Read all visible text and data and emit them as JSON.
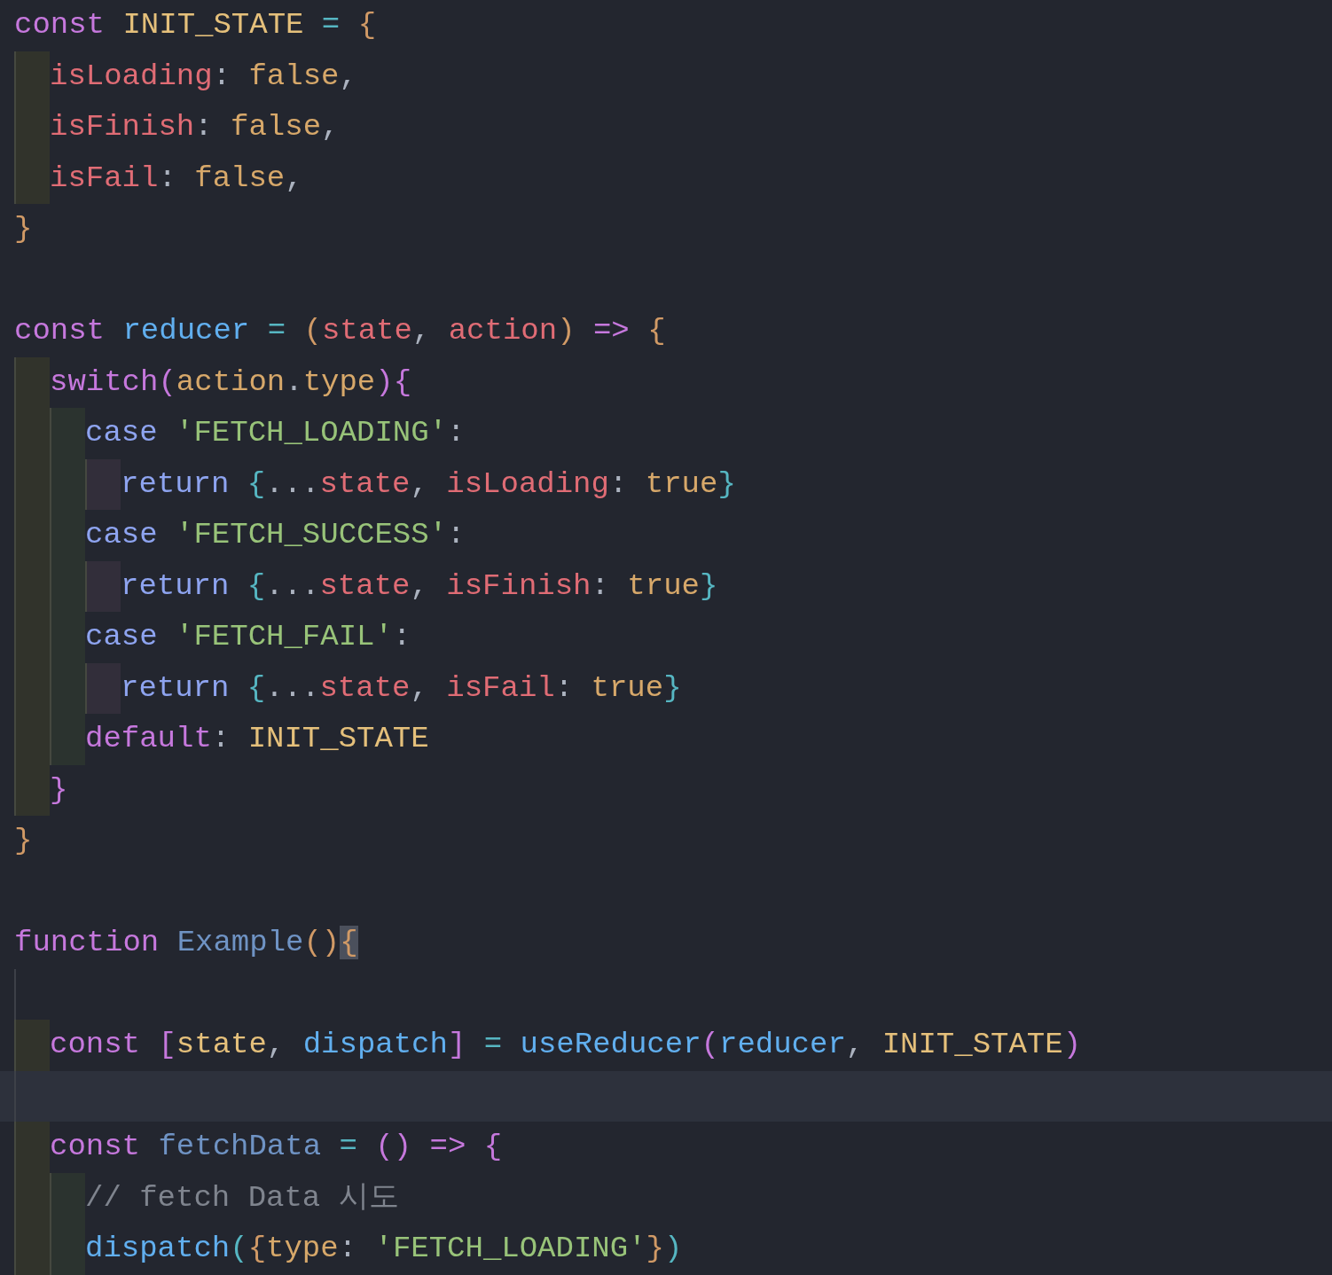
{
  "editor": {
    "lines": [
      {
        "kind": "code",
        "tokens": [
          {
            "kind": "kw",
            "text": "const "
          },
          {
            "kind": "const",
            "text": "INIT_STATE"
          },
          {
            "kind": "op",
            "text": " = "
          },
          {
            "kind": "b1",
            "text": "{"
          }
        ],
        "children": [
          {
            "kind": "code",
            "tokens": [
              {
                "kind": "prop",
                "text": "isLoading"
              },
              {
                "kind": "punc",
                "text": ": "
              },
              {
                "kind": "lit",
                "text": "false"
              },
              {
                "kind": "punc",
                "text": ","
              }
            ]
          },
          {
            "kind": "code",
            "tokens": [
              {
                "kind": "prop",
                "text": "isFinish"
              },
              {
                "kind": "punc",
                "text": ": "
              },
              {
                "kind": "lit",
                "text": "false"
              },
              {
                "kind": "punc",
                "text": ","
              }
            ]
          },
          {
            "kind": "code",
            "tokens": [
              {
                "kind": "prop",
                "text": "isFail"
              },
              {
                "kind": "punc",
                "text": ": "
              },
              {
                "kind": "lit",
                "text": "false"
              },
              {
                "kind": "punc",
                "text": ","
              }
            ]
          }
        ]
      },
      {
        "kind": "code",
        "tokens": [
          {
            "kind": "b1",
            "text": "}"
          }
        ]
      },
      {
        "kind": "blank"
      },
      {
        "kind": "code",
        "tokens": [
          {
            "kind": "kw",
            "text": "const "
          },
          {
            "kind": "call",
            "text": "reducer"
          },
          {
            "kind": "op",
            "text": " = "
          },
          {
            "kind": "b1",
            "text": "("
          },
          {
            "kind": "prop",
            "text": "state"
          },
          {
            "kind": "punc",
            "text": ", "
          },
          {
            "kind": "prop",
            "text": "action"
          },
          {
            "kind": "b1",
            "text": ")"
          },
          {
            "kind": "kw",
            "text": " => "
          },
          {
            "kind": "b1",
            "text": "{"
          }
        ],
        "children": [
          {
            "kind": "code",
            "tokens": [
              {
                "kind": "kw",
                "text": "switch"
              },
              {
                "kind": "b2",
                "text": "("
              },
              {
                "kind": "lit",
                "text": "action"
              },
              {
                "kind": "punc",
                "text": "."
              },
              {
                "kind": "lit",
                "text": "type"
              },
              {
                "kind": "b2",
                "text": ")"
              },
              {
                "kind": "b2",
                "text": "{"
              }
            ],
            "children": [
              {
                "kind": "code",
                "tokens": [
                  {
                    "kind": "ctl",
                    "text": "case "
                  },
                  {
                    "kind": "str",
                    "text": "'FETCH_LOADING'"
                  },
                  {
                    "kind": "punc",
                    "text": ":"
                  }
                ],
                "children": [
                  {
                    "kind": "code",
                    "tokens": [
                      {
                        "kind": "ctl",
                        "text": "return "
                      },
                      {
                        "kind": "b3",
                        "text": "{"
                      },
                      {
                        "kind": "punc",
                        "text": "..."
                      },
                      {
                        "kind": "prop",
                        "text": "state"
                      },
                      {
                        "kind": "punc",
                        "text": ", "
                      },
                      {
                        "kind": "prop",
                        "text": "isLoading"
                      },
                      {
                        "kind": "punc",
                        "text": ": "
                      },
                      {
                        "kind": "lit",
                        "text": "true"
                      },
                      {
                        "kind": "b3",
                        "text": "}"
                      }
                    ]
                  }
                ]
              },
              {
                "kind": "code",
                "tokens": [
                  {
                    "kind": "ctl",
                    "text": "case "
                  },
                  {
                    "kind": "str",
                    "text": "'FETCH_SUCCESS'"
                  },
                  {
                    "kind": "punc",
                    "text": ":"
                  }
                ],
                "children": [
                  {
                    "kind": "code",
                    "tokens": [
                      {
                        "kind": "ctl",
                        "text": "return "
                      },
                      {
                        "kind": "b3",
                        "text": "{"
                      },
                      {
                        "kind": "punc",
                        "text": "..."
                      },
                      {
                        "kind": "prop",
                        "text": "state"
                      },
                      {
                        "kind": "punc",
                        "text": ", "
                      },
                      {
                        "kind": "prop",
                        "text": "isFinish"
                      },
                      {
                        "kind": "punc",
                        "text": ": "
                      },
                      {
                        "kind": "lit",
                        "text": "true"
                      },
                      {
                        "kind": "b3",
                        "text": "}"
                      }
                    ]
                  }
                ]
              },
              {
                "kind": "code",
                "tokens": [
                  {
                    "kind": "ctl",
                    "text": "case "
                  },
                  {
                    "kind": "str",
                    "text": "'FETCH_FAIL'"
                  },
                  {
                    "kind": "punc",
                    "text": ":"
                  }
                ],
                "children": [
                  {
                    "kind": "code",
                    "tokens": [
                      {
                        "kind": "ctl",
                        "text": "return "
                      },
                      {
                        "kind": "b3",
                        "text": "{"
                      },
                      {
                        "kind": "punc",
                        "text": "..."
                      },
                      {
                        "kind": "prop",
                        "text": "state"
                      },
                      {
                        "kind": "punc",
                        "text": ", "
                      },
                      {
                        "kind": "prop",
                        "text": "isFail"
                      },
                      {
                        "kind": "punc",
                        "text": ": "
                      },
                      {
                        "kind": "lit",
                        "text": "true"
                      },
                      {
                        "kind": "b3",
                        "text": "}"
                      }
                    ]
                  }
                ]
              },
              {
                "kind": "code",
                "tokens": [
                  {
                    "kind": "kw",
                    "text": "default"
                  },
                  {
                    "kind": "punc",
                    "text": ": "
                  },
                  {
                    "kind": "const",
                    "text": "INIT_STATE"
                  }
                ]
              }
            ]
          },
          {
            "kind": "code",
            "tokens": [
              {
                "kind": "b2",
                "text": "}"
              }
            ]
          }
        ]
      },
      {
        "kind": "code",
        "tokens": [
          {
            "kind": "b1",
            "text": "}"
          }
        ]
      },
      {
        "kind": "blank"
      },
      {
        "kind": "code",
        "tokens": [
          {
            "kind": "kw",
            "text": "function "
          },
          {
            "kind": "fn",
            "text": "Example"
          },
          {
            "kind": "b1",
            "text": "()"
          },
          {
            "kind": "b1",
            "text": "{",
            "matched": true
          }
        ],
        "children": [
          {
            "kind": "blank"
          },
          {
            "kind": "code",
            "tokens": [
              {
                "kind": "kw",
                "text": "const "
              },
              {
                "kind": "b2",
                "text": "["
              },
              {
                "kind": "const",
                "text": "state"
              },
              {
                "kind": "punc",
                "text": ", "
              },
              {
                "kind": "call",
                "text": "dispatch"
              },
              {
                "kind": "b2",
                "text": "]"
              },
              {
                "kind": "op",
                "text": " = "
              },
              {
                "kind": "call",
                "text": "useReducer"
              },
              {
                "kind": "b2",
                "text": "("
              },
              {
                "kind": "call",
                "text": "reducer"
              },
              {
                "kind": "punc",
                "text": ", "
              },
              {
                "kind": "const",
                "text": "INIT_STATE"
              },
              {
                "kind": "b2",
                "text": ")"
              }
            ]
          },
          {
            "kind": "blank",
            "current": true
          },
          {
            "kind": "code",
            "tokens": [
              {
                "kind": "kw",
                "text": "const "
              },
              {
                "kind": "fn",
                "text": "fetchData"
              },
              {
                "kind": "op",
                "text": " = "
              },
              {
                "kind": "b2",
                "text": "()"
              },
              {
                "kind": "kw",
                "text": " => "
              },
              {
                "kind": "b2",
                "text": "{"
              }
            ],
            "children": [
              {
                "kind": "code",
                "tokens": [
                  {
                    "kind": "com",
                    "text": "// fetch Data 시도"
                  }
                ]
              },
              {
                "kind": "code",
                "tokens": [
                  {
                    "kind": "call",
                    "text": "dispatch"
                  },
                  {
                    "kind": "b3",
                    "text": "("
                  },
                  {
                    "kind": "b1",
                    "text": "{"
                  },
                  {
                    "kind": "lit",
                    "text": "type"
                  },
                  {
                    "kind": "punc",
                    "text": ": "
                  },
                  {
                    "kind": "str",
                    "text": "'FETCH_LOADING'"
                  },
                  {
                    "kind": "b1",
                    "text": "}"
                  },
                  {
                    "kind": "b3",
                    "text": ")"
                  }
                ]
              }
            ]
          }
        ]
      }
    ]
  }
}
